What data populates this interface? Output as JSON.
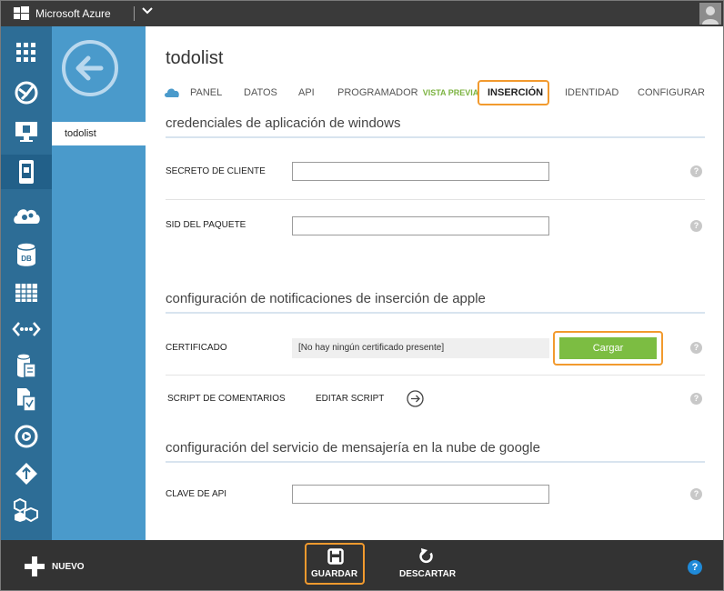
{
  "topbar": {
    "brand": "Microsoft Azure"
  },
  "rail": {
    "items": [
      {
        "icon": "all-items-icon"
      },
      {
        "icon": "websites-icon"
      },
      {
        "icon": "virtual-machines-icon"
      },
      {
        "icon": "mobile-services-icon"
      },
      {
        "icon": "cloud-services-icon"
      },
      {
        "icon": "sql-database-icon",
        "label": "DB"
      },
      {
        "icon": "storage-icon"
      },
      {
        "icon": "hdinsight-icon"
      },
      {
        "icon": "media-services-icon"
      },
      {
        "icon": "service-bus-icon"
      },
      {
        "icon": "visual-studio-online-icon"
      },
      {
        "icon": "cache-icon"
      },
      {
        "icon": "biztalk-services-icon"
      },
      {
        "icon": "addons-icon"
      }
    ]
  },
  "subnav": {
    "item": "todolist"
  },
  "main": {
    "title": "todolist",
    "tabs": [
      {
        "label": "PANEL"
      },
      {
        "label": "DATOS"
      },
      {
        "label": "API"
      },
      {
        "label": "PROGRAMADOR",
        "badge": "VISTA PREVIA"
      },
      {
        "label": "INSERCIÓN"
      },
      {
        "label": "IDENTIDAD"
      },
      {
        "label": "CONFIGURAR"
      }
    ],
    "windows": {
      "title": "credenciales de aplicación de windows",
      "client_secret_label": "SECRETO DE CLIENTE",
      "client_secret_value": "",
      "package_sid_label": "SID DEL PAQUETE",
      "package_sid_value": ""
    },
    "apple": {
      "title": "configuración de notificaciones de inserción de apple",
      "certificate_label": "CERTIFICADO",
      "certificate_value": "[No hay ningún certificado presente]",
      "upload_label": "Cargar",
      "feedback_label": "SCRIPT DE COMENTARIOS",
      "edit_script_label": "EDITAR SCRIPT"
    },
    "google": {
      "title": "configuración del servicio de mensajería en la nube de google",
      "api_key_label": "CLAVE DE API",
      "api_key_value": ""
    },
    "help_glyph": "?"
  },
  "bottombar": {
    "new_label": "NUEVO",
    "save_label": "GUARDAR",
    "discard_label": "DESCARTAR",
    "help_glyph": "?"
  },
  "colors": {
    "rail": "#2d6d96",
    "subnav": "#4a9acb",
    "highlight": "#f29a2e",
    "upload": "#7cbd42",
    "preview_badge": "#7cb341"
  }
}
